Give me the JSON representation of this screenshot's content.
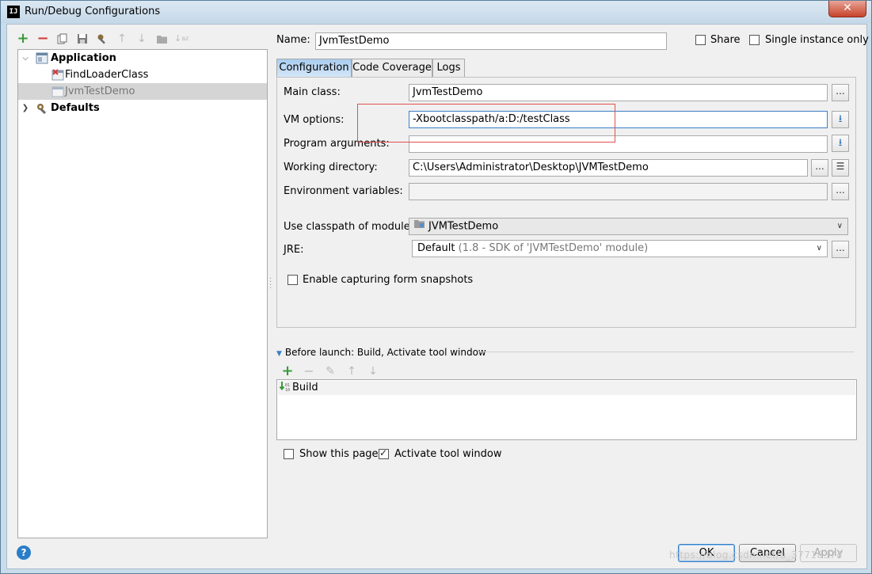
{
  "window": {
    "title": "Run/Debug Configurations",
    "app_icon": "IJ"
  },
  "toolbar_icons": [
    "add-icon",
    "remove-icon",
    "copy-icon",
    "save-icon",
    "wrench-icon",
    "arrow-up-icon",
    "arrow-down-icon",
    "folder-icon",
    "sort-icon"
  ],
  "tree": {
    "items": [
      {
        "label": "Application",
        "bold": true,
        "expanded": true,
        "icon": "application-icon"
      },
      {
        "label": "FindLoaderClass",
        "icon": "app-config-error-icon"
      },
      {
        "label": "JvmTestDemo",
        "icon": "app-config-icon",
        "selected": true
      },
      {
        "label": "Defaults",
        "bold": true,
        "expanded": false,
        "icon": "wrench-icon"
      }
    ]
  },
  "header": {
    "name_label": "Name:",
    "name_value": "JvmTestDemo",
    "share_label": "Share",
    "share_checked": false,
    "single_instance_label": "Single instance only",
    "single_instance_checked": false
  },
  "tabs": [
    {
      "label": "Configuration",
      "active": true
    },
    {
      "label": "Code Coverage",
      "active": false
    },
    {
      "label": "Logs",
      "active": false
    }
  ],
  "config": {
    "main_class_label": "Main class:",
    "main_class_value": "JvmTestDemo",
    "vm_options_label": "VM options:",
    "vm_options_value": "-Xbootclasspath/a:D:/testClass",
    "program_args_label": "Program arguments:",
    "program_args_value": "",
    "working_dir_label": "Working directory:",
    "working_dir_value": "C:\\Users\\Administrator\\Desktop\\JVMTestDemo",
    "env_vars_label": "Environment variables:",
    "env_vars_value": "",
    "classpath_label": "Use classpath of module:",
    "classpath_value": "JVMTestDemo",
    "jre_label": "JRE:",
    "jre_value": "Default",
    "jre_detail": "(1.8 - SDK of 'JVMTestDemo' module)",
    "snapshots_label": "Enable capturing form snapshots",
    "snapshots_checked": false,
    "ellipsis": "..."
  },
  "before_launch": {
    "title": "Before launch: Build, Activate tool window",
    "items": [
      "Build"
    ]
  },
  "footer": {
    "show_page_label": "Show this page",
    "show_page_checked": false,
    "activate_label": "Activate tool window",
    "activate_checked": true,
    "ok_label": "OK",
    "cancel_label": "Cancel",
    "apply_label": "Apply",
    "help_label": "?",
    "watermark": "https://blog.csdn.net/u_37718374"
  },
  "colors": {
    "accent": "#3c7fc8",
    "highlight_box": "#e05050",
    "tab_active": "#a9cdf0",
    "selection": "#d5d5d5"
  }
}
